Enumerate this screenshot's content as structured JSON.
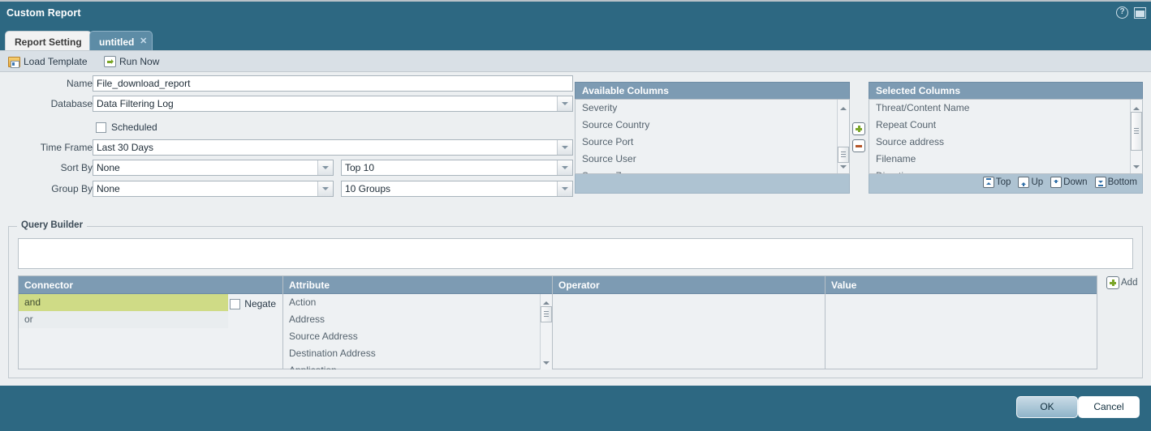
{
  "window": {
    "title": "Custom Report",
    "help_icon": "help-circle-icon",
    "restore_icon": "restore-window-icon",
    "help_glyph": "?"
  },
  "tabs": [
    {
      "label": "Report Setting",
      "active": true
    },
    {
      "label": "untitled",
      "active": false,
      "close_glyph": "✕"
    }
  ],
  "toolbar": {
    "load_template": "Load Template",
    "run_now": "Run Now",
    "load_icon": "folder-report-icon",
    "run_icon": "arrow-right-icon"
  },
  "form": {
    "name": {
      "label": "Name",
      "value": "File_download_report"
    },
    "database": {
      "label": "Database",
      "value": "Data Filtering Log"
    },
    "scheduled": {
      "label": "Scheduled",
      "checked": false
    },
    "time_frame": {
      "label": "Time Frame",
      "value": "Last 30 Days"
    },
    "sort_by": {
      "label": "Sort By",
      "value": "None",
      "count_value": "Top 10"
    },
    "group_by": {
      "label": "Group By",
      "value": "None",
      "count_value": "10 Groups"
    }
  },
  "available_columns": {
    "title": "Available Columns",
    "items": [
      "Severity",
      "Source Country",
      "Source Port",
      "Source User",
      "Source Zone"
    ]
  },
  "selected_columns": {
    "title": "Selected Columns",
    "items": [
      "Threat/Content Name",
      "Repeat Count",
      "Source address",
      "Filename",
      "Direction"
    ],
    "order_buttons": [
      {
        "label": "Top",
        "icon": "move-to-top-icon"
      },
      {
        "label": "Up",
        "icon": "move-up-icon"
      },
      {
        "label": "Down",
        "icon": "move-down-icon"
      },
      {
        "label": "Bottom",
        "icon": "move-to-bottom-icon"
      }
    ]
  },
  "move_buttons": {
    "add": {
      "icon": "add-column-icon"
    },
    "remove": {
      "icon": "remove-column-icon"
    }
  },
  "query_builder": {
    "legend": "Query Builder",
    "expression": "",
    "add_label": "Add",
    "add_icon": "add-row-icon",
    "negate": {
      "label": "Negate",
      "checked": false
    },
    "columns": [
      {
        "header": "Connector",
        "items": [
          "and",
          "or"
        ],
        "selected_index": 0
      },
      {
        "header": "Attribute",
        "items": [
          "Action",
          "Address",
          "Source Address",
          "Destination Address",
          "Application"
        ],
        "selected_index": -1
      },
      {
        "header": "Operator",
        "items": [],
        "selected_index": -1
      },
      {
        "header": "Value",
        "items": [],
        "selected_index": -1
      }
    ]
  },
  "footer": {
    "ok": "OK",
    "cancel": "Cancel"
  },
  "colors": {
    "titlebar": "#2d6882",
    "panel_bg": "#eceff1",
    "header_blue": "#7d9bb3",
    "selection_green": "#cfdb86",
    "list_bg": "#eef1f3",
    "footer_blue": "#aec3d2"
  }
}
